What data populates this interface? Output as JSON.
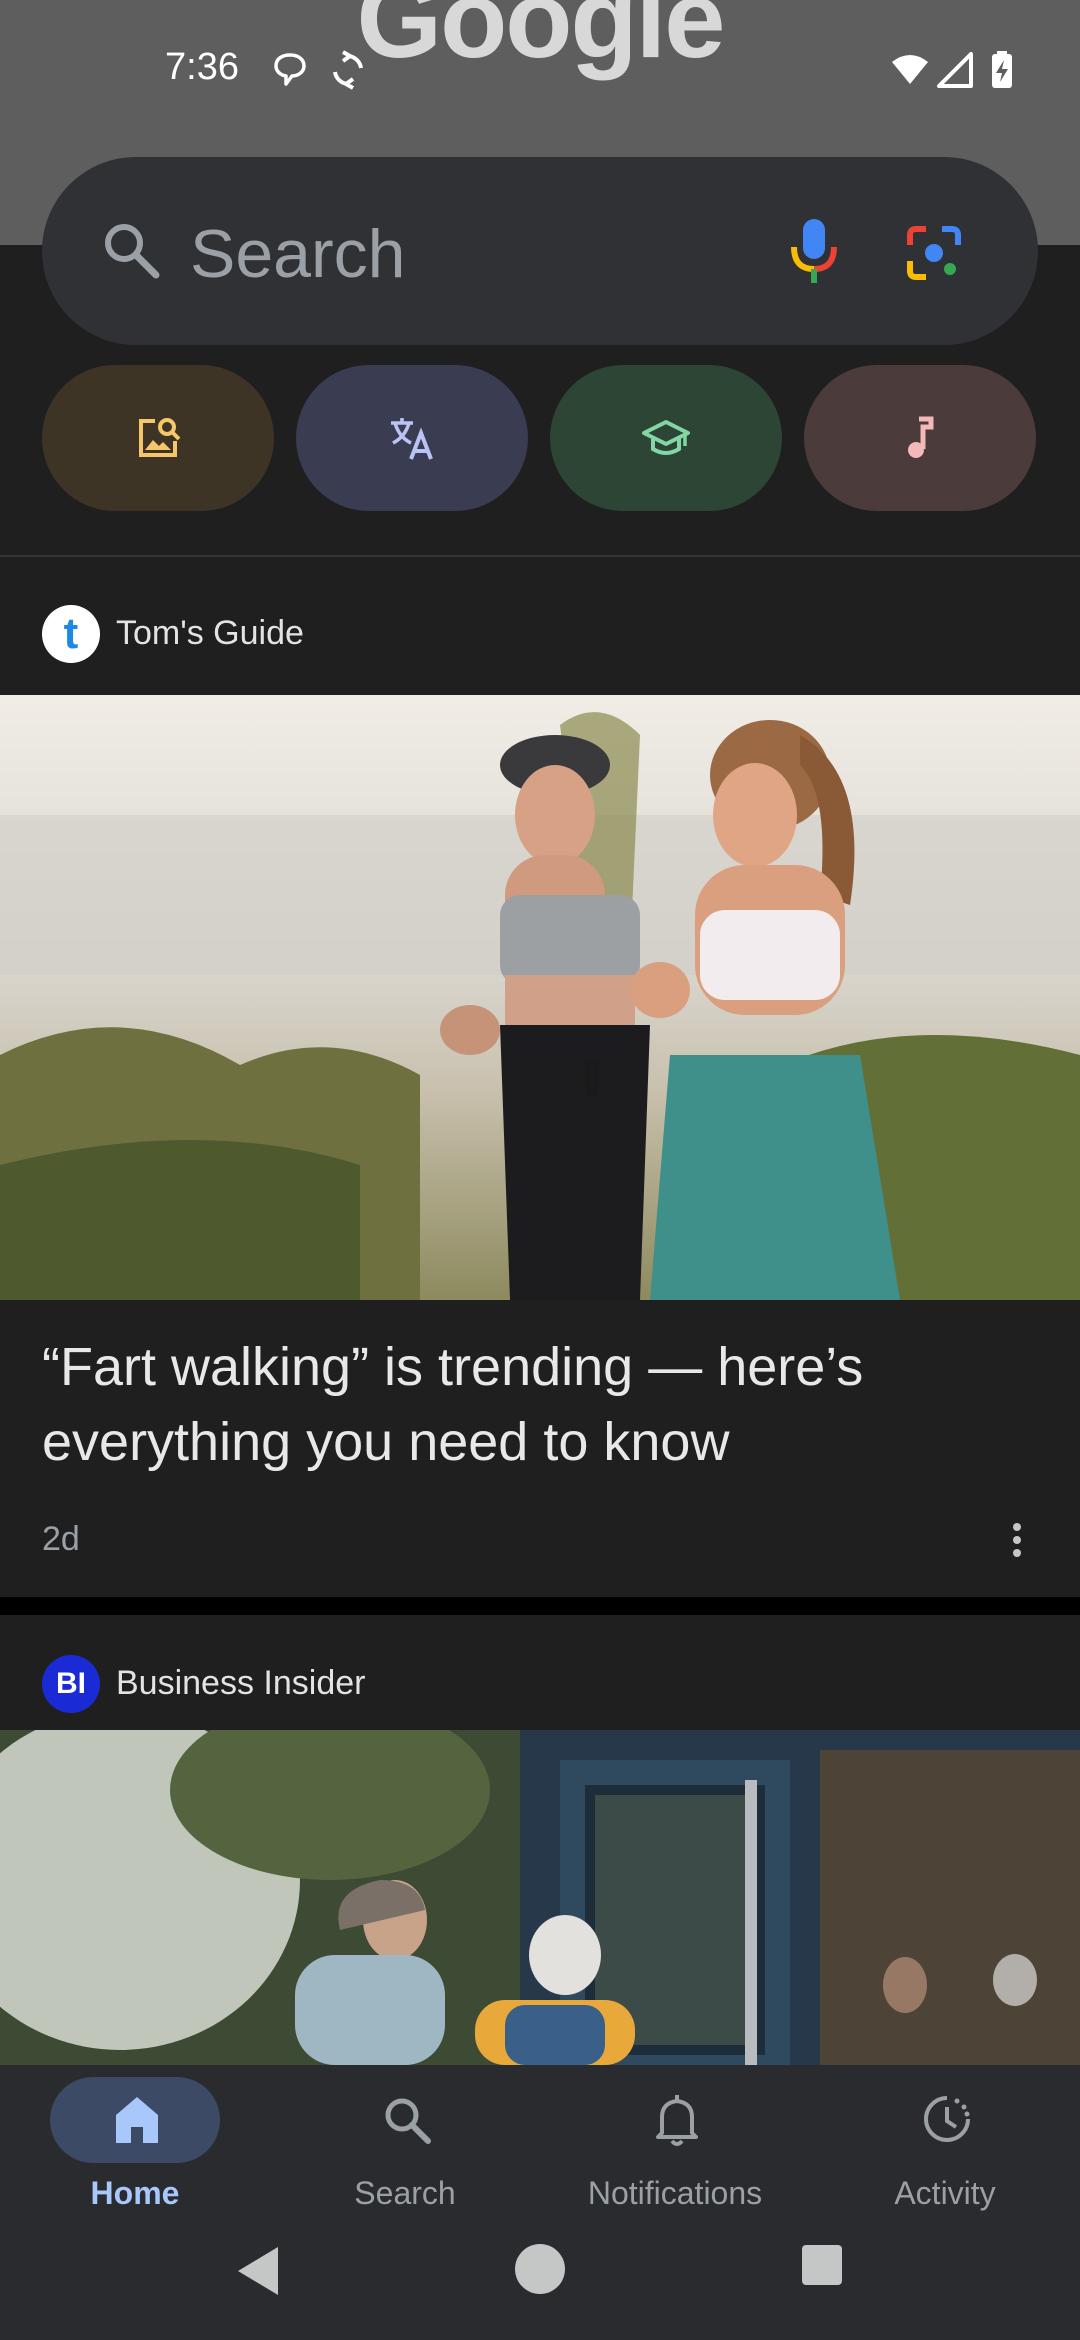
{
  "status_bar": {
    "time": "7:36"
  },
  "header": {
    "logo_text": "Google"
  },
  "search": {
    "placeholder": "Search"
  },
  "chips": [
    {
      "name": "image-search",
      "color": "#3d3425",
      "icon_color": "#f5c66b"
    },
    {
      "name": "translate",
      "color": "#3a3d52",
      "icon_color": "#b9c3f5"
    },
    {
      "name": "homework",
      "color": "#2c4535",
      "icon_color": "#82d7a4"
    },
    {
      "name": "song-search",
      "color": "#4b3b3b",
      "icon_color": "#f3b8b8"
    }
  ],
  "feed": [
    {
      "source": "Tom's Guide",
      "source_logo_text": "t",
      "headline": "“Fart walking” is trending — here’s everything you need to know",
      "age": "2d"
    },
    {
      "source": "Business Insider",
      "source_logo_text": "BI"
    }
  ],
  "bottom_nav": {
    "items": [
      {
        "label": "Home",
        "active": true
      },
      {
        "label": "Search",
        "active": false
      },
      {
        "label": "Notifications",
        "active": false
      },
      {
        "label": "Activity",
        "active": false
      }
    ]
  },
  "colors": {
    "accent": "#a8c7fa",
    "background": "#1f1f20"
  }
}
